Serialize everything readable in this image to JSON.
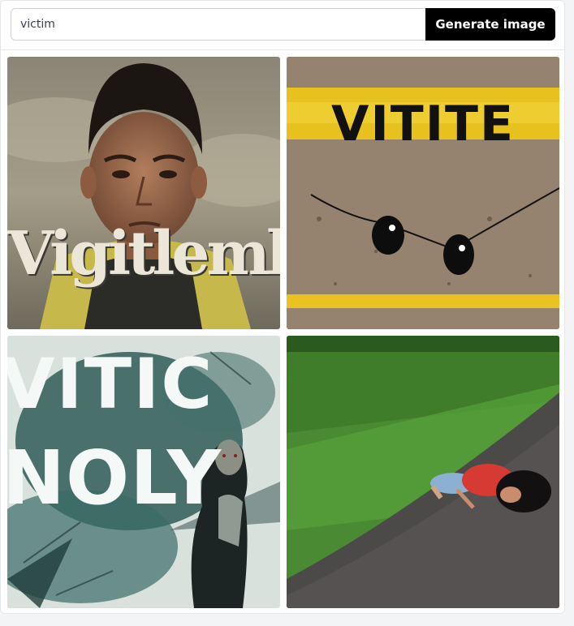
{
  "search": {
    "value": "victim",
    "button_label": "Generate image"
  },
  "images": [
    {
      "caption": "Vigitlemb",
      "description": "young man portrait under stormy sky"
    },
    {
      "caption": "VITITE",
      "description": "chalk road with yellow lines and blob figures"
    },
    {
      "caption_top": "VITIC",
      "caption_bottom": "NOLY",
      "description": "teal grunge poster with figure"
    },
    {
      "caption": "",
      "description": "person lying on path beside grass"
    }
  ],
  "colors": {
    "button_bg": "#000000",
    "button_text": "#ffffff",
    "border": "#e5e7eb"
  }
}
